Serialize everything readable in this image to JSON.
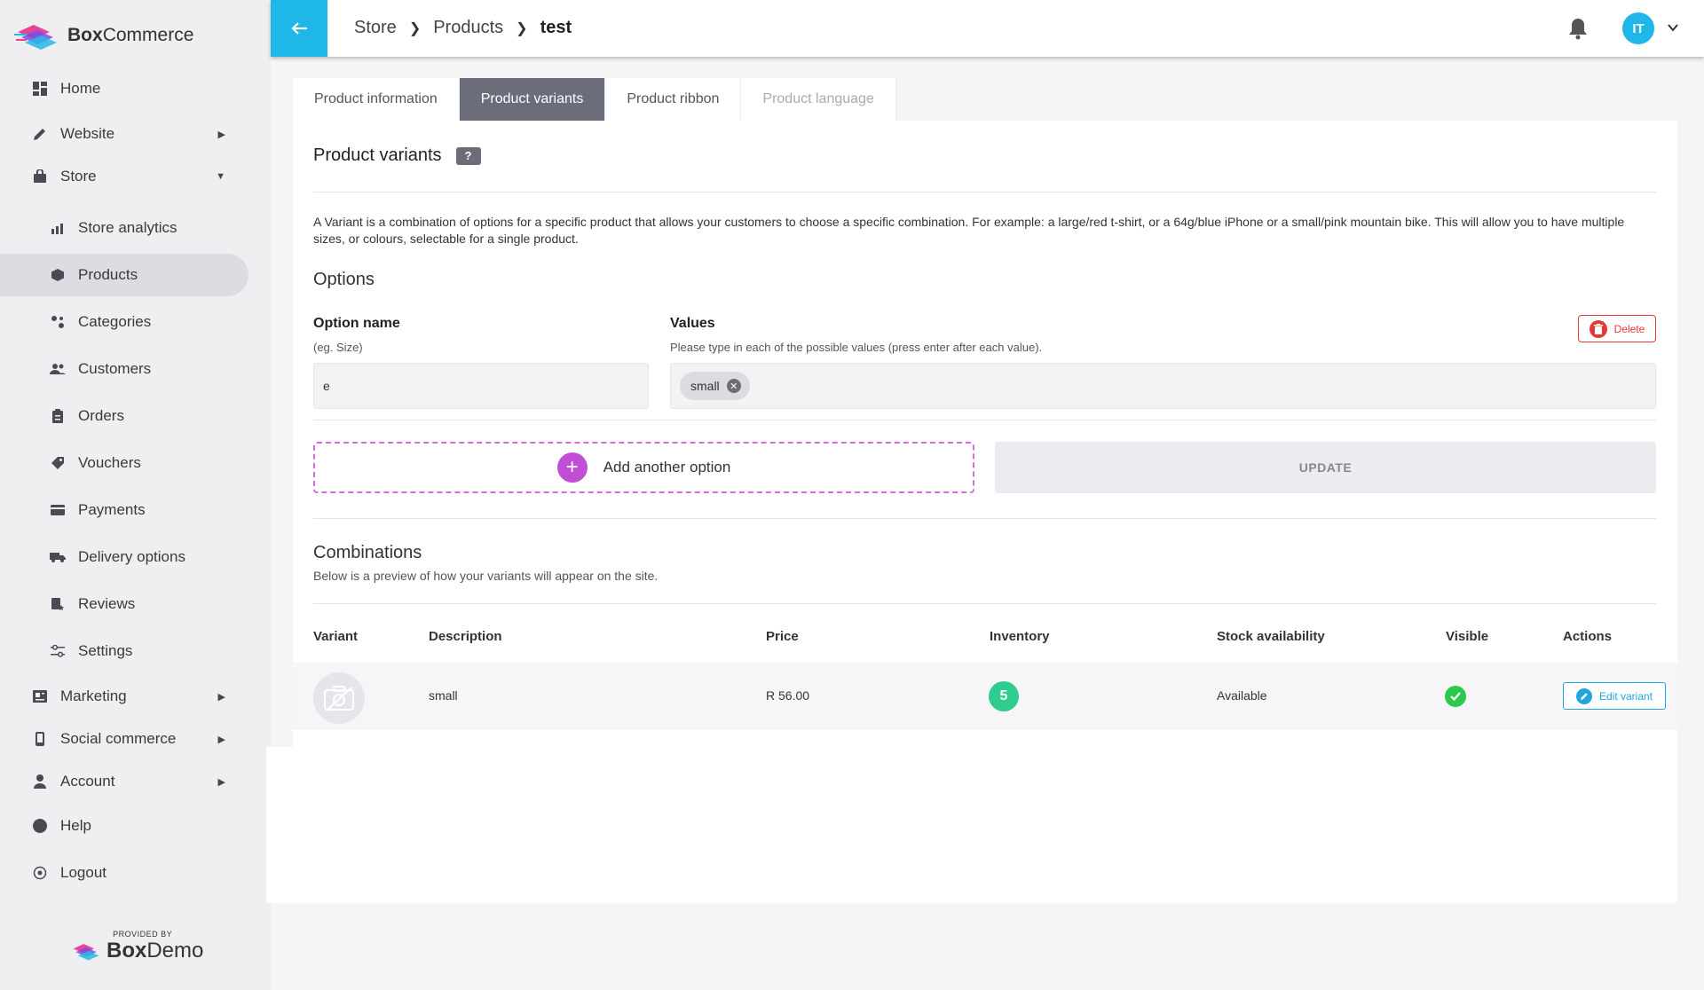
{
  "brand": {
    "logo_bold": "Box",
    "logo_rest": "Commerce",
    "provided_by": "PROVIDED BY",
    "provider_bold": "Box",
    "provider_rest": "Demo"
  },
  "sidebar": {
    "items": [
      {
        "label": "Home",
        "icon": "dashboard-icon"
      },
      {
        "label": "Website",
        "icon": "pencil-icon"
      },
      {
        "label": "Store",
        "icon": "bag-icon"
      },
      {
        "label": "Store analytics",
        "icon": "analytics-icon"
      },
      {
        "label": "Products",
        "icon": "cube-icon"
      },
      {
        "label": "Categories",
        "icon": "categories-icon"
      },
      {
        "label": "Customers",
        "icon": "people-icon"
      },
      {
        "label": "Orders",
        "icon": "clipboard-icon"
      },
      {
        "label": "Vouchers",
        "icon": "tag-icon"
      },
      {
        "label": "Payments",
        "icon": "card-icon"
      },
      {
        "label": "Delivery options",
        "icon": "truck-icon"
      },
      {
        "label": "Reviews",
        "icon": "reviews-icon"
      },
      {
        "label": "Settings",
        "icon": "sliders-icon"
      },
      {
        "label": "Marketing",
        "icon": "newspaper-icon"
      },
      {
        "label": "Social commerce",
        "icon": "phone-icon"
      },
      {
        "label": "Account",
        "icon": "person-icon"
      },
      {
        "label": "Help",
        "icon": "help-icon"
      },
      {
        "label": "Logout",
        "icon": "logout-icon"
      }
    ]
  },
  "topbar": {
    "breadcrumbs": [
      "Store",
      "Products",
      "test"
    ],
    "avatar_initials": "IT"
  },
  "tabs": [
    "Product information",
    "Product variants",
    "Product ribbon",
    "Product language"
  ],
  "variants": {
    "title": "Product variants",
    "help_badge": "?",
    "description": "A Variant is a combination of options for a specific product that allows your customers to choose a specific combination. For example: a large/red t-shirt, or a 64g/blue iPhone or a small/pink mountain bike. This will allow you to have multiple sizes, or colours, selectable for a single product.",
    "options_heading": "Options",
    "option_name_label": "Option name",
    "option_name_hint": "(eg. Size)",
    "option_name_value": "e",
    "values_label": "Values",
    "values_hint": "Please type in each of the possible values (press enter after each value).",
    "value_chips": [
      "small"
    ],
    "delete_label": "Delete",
    "add_option_label": "Add another option",
    "update_label": "UPDATE"
  },
  "combinations": {
    "heading": "Combinations",
    "subheading": "Below is a preview of how your variants will appear on the site.",
    "columns": [
      "Variant",
      "Description",
      "Price",
      "Inventory",
      "Stock availability",
      "Visible",
      "Actions"
    ],
    "rows": [
      {
        "description": "small",
        "price": "R 56.00",
        "inventory": "5",
        "stock": "Available",
        "action": "Edit variant"
      }
    ]
  },
  "colors": {
    "accent": "#1fb6e8",
    "active_tab": "#6b6d7a",
    "delete": "#e53935",
    "add_option": "#c14fd6",
    "inventory": "#2ecc8f",
    "visible": "#2ec94a"
  }
}
